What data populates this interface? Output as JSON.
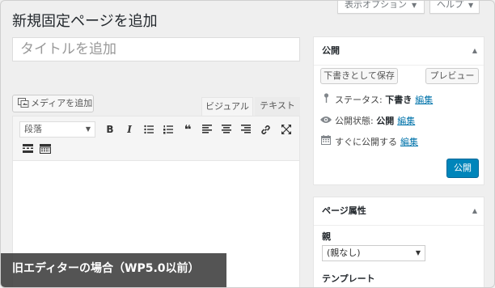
{
  "header": {
    "title": "新規固定ページを追加",
    "screen_options_label": "表示オプション",
    "help_label": "ヘルプ"
  },
  "title_input": {
    "placeholder": "タイトルを追加"
  },
  "media_button": {
    "label": "メディアを追加"
  },
  "editor_tabs": {
    "visual": "ビジュアル",
    "text": "テキスト"
  },
  "toolbar": {
    "format_value": "段落",
    "bold": "B",
    "italic": "I",
    "icons": [
      "bulleted-list-icon",
      "numbered-list-icon",
      "blockquote-icon",
      "align-left-icon",
      "align-center-icon",
      "align-right-icon",
      "link-icon",
      "fullscreen-icon",
      "read-more-icon",
      "toolbar-toggle-icon"
    ]
  },
  "publish_box": {
    "title": "公開",
    "save_draft_label": "下書きとして保存",
    "preview_label": "プレビュー",
    "status_label": "ステータス:",
    "status_value": "下書き",
    "visibility_label": "公開状態:",
    "visibility_value": "公開",
    "schedule_label": "すぐに公開する",
    "edit_link": "編集",
    "publish_label": "公開"
  },
  "attributes_box": {
    "title": "ページ属性",
    "parent_label": "親",
    "parent_value": "(親なし)",
    "template_label": "テンプレート"
  },
  "caption": {
    "text": "旧エディターの場合（WP5.0以前）"
  },
  "colors": {
    "primary": "#0085ba",
    "link": "#0073aa",
    "background": "#efefef"
  }
}
